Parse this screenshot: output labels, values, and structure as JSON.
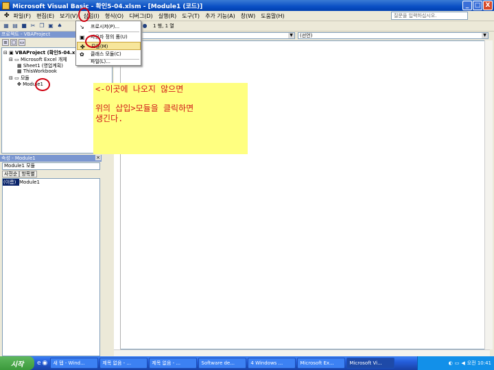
{
  "window": {
    "title": "Microsoft Visual Basic - 확인5-04.xlsm - [Module1 (코드)]",
    "controls": [
      "_",
      "□",
      "X"
    ]
  },
  "menubar": {
    "items": [
      "파일(F)",
      "편집(E)",
      "보기(V)",
      "삽입(I)",
      "형식(O)",
      "디버그(D)",
      "실행(R)",
      "도구(T)",
      "추가 기능(A)",
      "창(W)",
      "도움말(H)"
    ],
    "help_placeholder": "질문을 입력하십시오."
  },
  "toolbar": {
    "position": "1 행, 1 열"
  },
  "insert_menu": {
    "items": [
      {
        "label": "프로시저(P)...",
        "icon": "procedure-icon"
      },
      {
        "label": "사용자 정의 폼(U)",
        "icon": "userform-icon"
      },
      {
        "label": "모듈(M)",
        "icon": "module-icon",
        "highlighted": true
      },
      {
        "label": "클래스 모듈(C)",
        "icon": "class-module-icon"
      },
      {
        "label": "파일(L)...",
        "icon": ""
      }
    ]
  },
  "project": {
    "title": "프로젝트 - VBAProject",
    "tree": [
      {
        "label": "VBAProject (확인5-04.x",
        "level": 0
      },
      {
        "label": "Microsoft Excel 개체",
        "level": 1
      },
      {
        "label": "Sheet1 (영업계획)",
        "level": 2
      },
      {
        "label": "ThisWorkbook",
        "level": 2
      },
      {
        "label": "모듈",
        "level": 1
      },
      {
        "label": "Module1",
        "level": 2
      }
    ]
  },
  "properties": {
    "title": "속성 - Module1",
    "object": "Module1 모듈",
    "tabs": [
      "사전순",
      "항목별"
    ],
    "rows": [
      {
        "key": "(이름)",
        "value": "Module1"
      }
    ]
  },
  "code": {
    "object_combo": "",
    "proc_combo": "(선언)"
  },
  "note": {
    "line1": "<-이곳에 나오지 않으면",
    "line2": "위의 삽입>모듈을 클릭하면",
    "line3": "생긴다."
  },
  "taskbar": {
    "start": "시작",
    "tasks": [
      "새 탭 - Wind...",
      "제목 없음 - ...",
      "제목 없음 - ...",
      "Software de...",
      "4 Windows ...",
      "Microsoft Ex...",
      "Microsoft Vi..."
    ],
    "clock": "오전 10:41"
  },
  "colors": {
    "note_bg": "#ffff80",
    "note_text": "#d01818",
    "annotation_circle": "#d00010"
  }
}
